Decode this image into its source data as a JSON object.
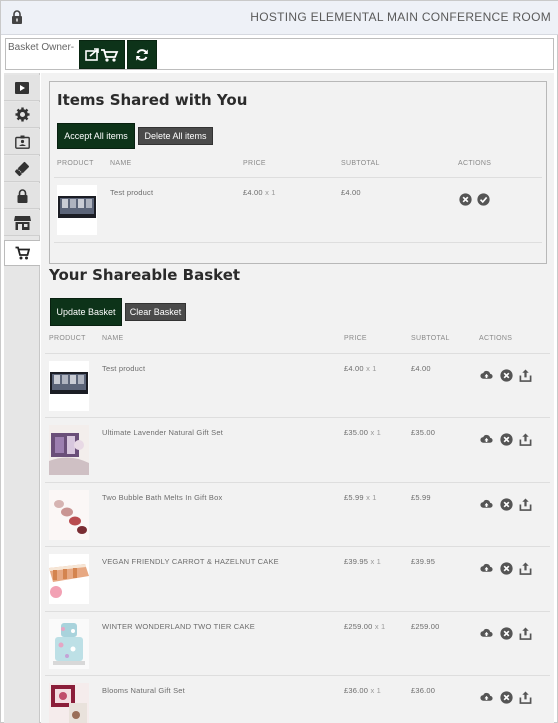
{
  "header": {
    "room_title": "HOSTING ELEMENTAL MAIN CONFERENCE ROOM"
  },
  "owner_bar": {
    "label": "Basket Owner-"
  },
  "shared": {
    "title": "Items Shared with You",
    "accept_label": "Accept All items",
    "delete_label": "Delete All items",
    "columns": {
      "product": "PRODUCT",
      "name": "NAME",
      "price": "PRICE",
      "subtotal": "SUBTOTAL",
      "actions": "ACTIONS"
    },
    "items": [
      {
        "name": "Test product",
        "price": "£4.00",
        "qty": "x 1",
        "subtotal": "£4.00"
      }
    ]
  },
  "basket": {
    "title": "Your Shareable Basket",
    "update_label": "Update Basket",
    "clear_label": "Clear Basket",
    "columns": {
      "product": "PRODUCT",
      "name": "NAME",
      "price": "PRICE",
      "subtotal": "SUBTOTAL",
      "actions": "ACTIONS"
    },
    "items": [
      {
        "name": "Test product",
        "price": "£4.00",
        "qty": "x 1",
        "subtotal": "£4.00"
      },
      {
        "name": "Ultimate Lavender Natural Gift Set",
        "price": "£35.00",
        "qty": "x 1",
        "subtotal": "£35.00"
      },
      {
        "name": "Two Bubble Bath Melts In Gift Box",
        "price": "£5.99",
        "qty": "x 1",
        "subtotal": "£5.99"
      },
      {
        "name": "VEGAN FRIENDLY CARROT & HAZELNUT CAKE",
        "price": "£39.95",
        "qty": "x 1",
        "subtotal": "£39.95"
      },
      {
        "name": "WINTER WONDERLAND TWO TIER CAKE",
        "price": "£259.00",
        "qty": "x 1",
        "subtotal": "£259.00"
      },
      {
        "name": "Blooms Natural Gift Set",
        "price": "£36.00",
        "qty": "x 1",
        "subtotal": "£36.00"
      }
    ]
  },
  "colors": {
    "accent_green": "#0d3319",
    "grey_button": "#4b4b4b",
    "icon_grey": "#555555"
  }
}
